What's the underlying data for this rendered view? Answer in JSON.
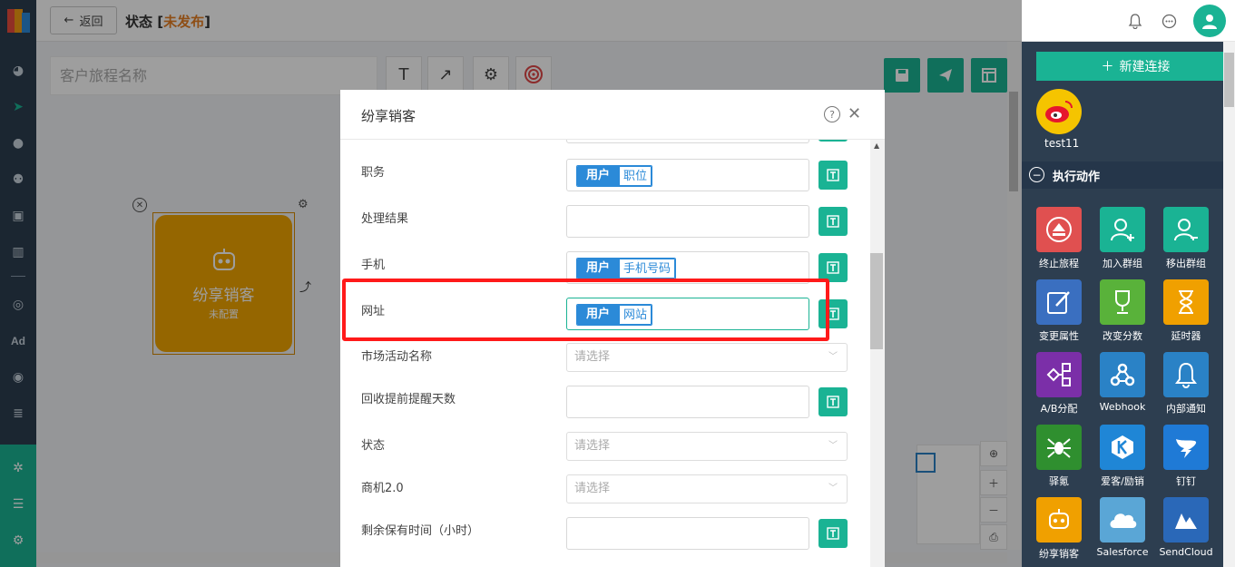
{
  "header": {
    "back_label": "返回",
    "status_prefix": "状态 [",
    "status_value": "未发布",
    "status_suffix": "]"
  },
  "canvas": {
    "journey_name_placeholder": "客户旅程名称",
    "node": {
      "title": "纷享销客",
      "subtitle": "未配置"
    }
  },
  "modal": {
    "title": "纷享销客",
    "fields": [
      {
        "label": "职务",
        "type": "tag",
        "tag_a": "用户",
        "tag_b": "职位"
      },
      {
        "label": "处理结果",
        "type": "text"
      },
      {
        "label": "手机",
        "type": "tag",
        "tag_a": "用户",
        "tag_b": "手机号码"
      },
      {
        "label": "网址",
        "type": "tag",
        "tag_a": "用户",
        "tag_b": "网站"
      },
      {
        "label": "市场活动名称",
        "type": "select",
        "placeholder": "请选择"
      },
      {
        "label": "回收提前提醒天数",
        "type": "text"
      },
      {
        "label": "状态",
        "type": "select",
        "placeholder": "请选择"
      },
      {
        "label": "商机2.0",
        "type": "select",
        "placeholder": "请选择"
      },
      {
        "label": "剩余保有时间（小时）",
        "type": "text"
      }
    ]
  },
  "right_panel": {
    "new_connection_label": "新建连接",
    "connector_label": "test11",
    "section_title": "执行动作",
    "actions": [
      {
        "label": "终止旅程",
        "color": "#e05050",
        "icon": "eject-icon"
      },
      {
        "label": "加入群组",
        "color": "#1ab394",
        "icon": "user-plus-icon"
      },
      {
        "label": "移出群组",
        "color": "#1ab394",
        "icon": "user-minus-icon"
      },
      {
        "label": "变更属性",
        "color": "#3a6fc0",
        "icon": "edit-icon"
      },
      {
        "label": "改变分数",
        "color": "#59b23a",
        "icon": "trophy-icon"
      },
      {
        "label": "延时器",
        "color": "#f0a000",
        "icon": "hourglass-icon"
      },
      {
        "label": "A/B分配",
        "color": "#7b2fa8",
        "icon": "split-icon"
      },
      {
        "label": "Webhook",
        "color": "#2a82c6",
        "icon": "webhook-icon"
      },
      {
        "label": "内部通知",
        "color": "#2a82c6",
        "icon": "bell-icon"
      },
      {
        "label": "驿氪",
        "color": "#2f8f2f",
        "icon": "spider-icon"
      },
      {
        "label": "爱客/励销",
        "color": "#1f86d6",
        "icon": "k-logo-icon"
      },
      {
        "label": "钉钉",
        "color": "#1f7ad6",
        "icon": "dingtalk-icon"
      },
      {
        "label": "纷享销客",
        "color": "#f0a000",
        "icon": "robot-icon"
      },
      {
        "label": "Salesforce",
        "color": "#5aa6d6",
        "icon": "cloud-icon"
      },
      {
        "label": "SendCloud",
        "color": "#2a68b8",
        "icon": "sendcloud-icon"
      }
    ]
  }
}
